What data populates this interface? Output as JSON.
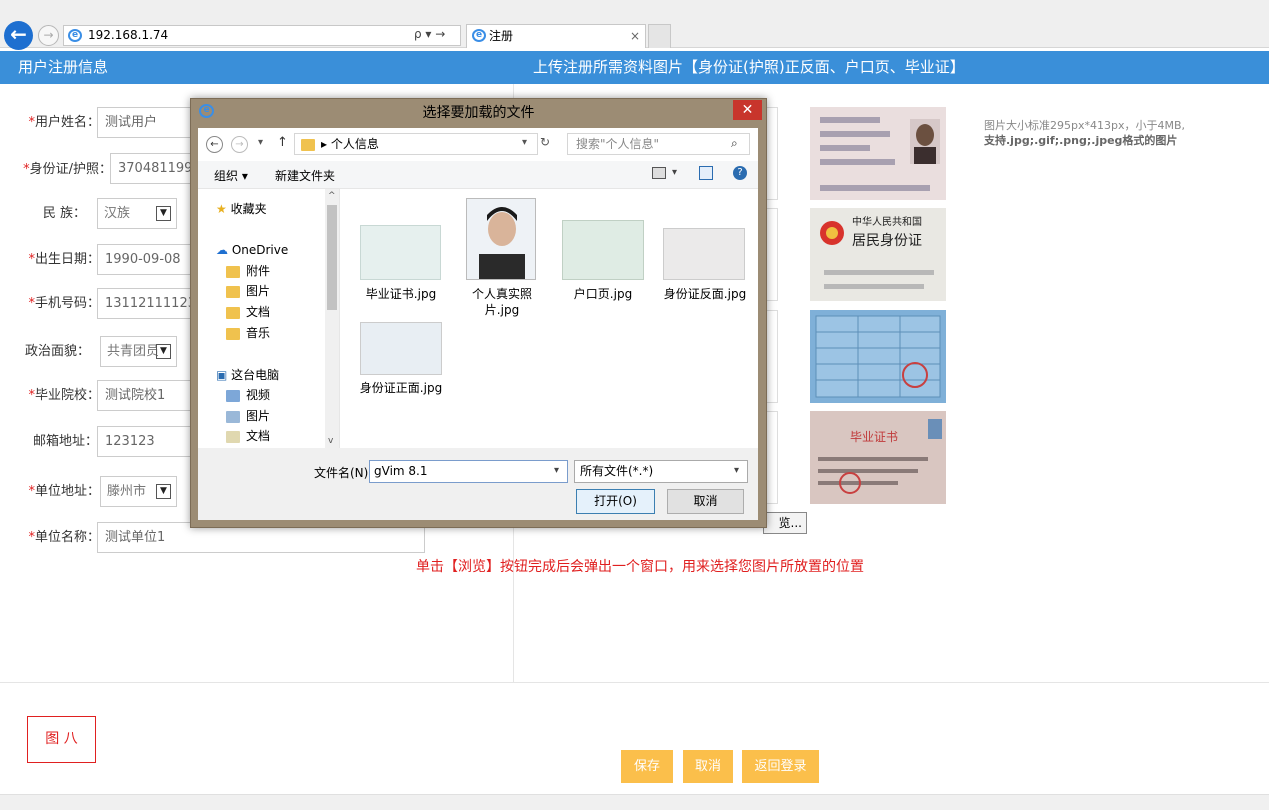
{
  "browser": {
    "address": "192.168.1.74",
    "addr_tools": "ρ ▾ →",
    "tab_title": "注册"
  },
  "header": {
    "left_title": "用户注册信息",
    "right_title": "上传注册所需资料图片【身份证(护照)正反面、户口页、毕业证】"
  },
  "form": {
    "name_label": "用户姓名：",
    "name_value": "测试用户",
    "id_label": "身份证/护照：",
    "id_value": "370481199",
    "ethnic_label": "民 族：",
    "ethnic_value": "汉族",
    "birth_label": "出生日期：",
    "birth_value": "1990-09-08",
    "phone_label": "手机号码：",
    "phone_value": "13112111123",
    "political_label": "政治面貌：",
    "political_value": "共青团员",
    "school_label": "毕业院校：",
    "school_value": "测试院校1",
    "mail_label": "邮箱地址：",
    "mail_value": "123123",
    "work_addr_label": "单位地址：",
    "work_addr_value": "滕州市",
    "work_name_label": "单位名称：",
    "work_name_value": "测试单位1"
  },
  "upload": {
    "note_text": "图片大小标准295px*413px，小于4MB,",
    "note_formats": "支持.jpg;.gif;.png;.jpeg格式的图片",
    "browse_label": "览...",
    "hint": "单击【浏览】按钮完成后会弹出一个窗口，用来选择您图片所放置的位置",
    "id_front_card_title": "中华人民共和国",
    "id_back_card_title": "居民身份证",
    "diploma_title": "毕业证书"
  },
  "figure_label": "图 八",
  "buttons": {
    "save": "保存",
    "cancel": "取消",
    "back": "返回登录"
  },
  "dialog": {
    "title": "选择要加载的文件",
    "close": "✕",
    "path": "▸ 个人信息",
    "search_placeholder": "搜索\"个人信息\"",
    "organize": "组织 ▾",
    "new_folder": "新建文件夹",
    "tree": [
      "收藏夹",
      "OneDrive",
      "附件",
      "图片",
      "文档",
      "音乐",
      "这台电脑",
      "视频",
      "图片",
      "文档"
    ],
    "files": [
      "毕业证书.jpg",
      "个人真实照片.jpg",
      "户口页.jpg",
      "身份证反面.jpg",
      "身份证正面.jpg"
    ],
    "filename_label": "文件名(N):",
    "filename_value": "gVim 8.1",
    "filetype_value": "所有文件(*.*)",
    "open": "打开(O)",
    "cancel": "取消"
  }
}
